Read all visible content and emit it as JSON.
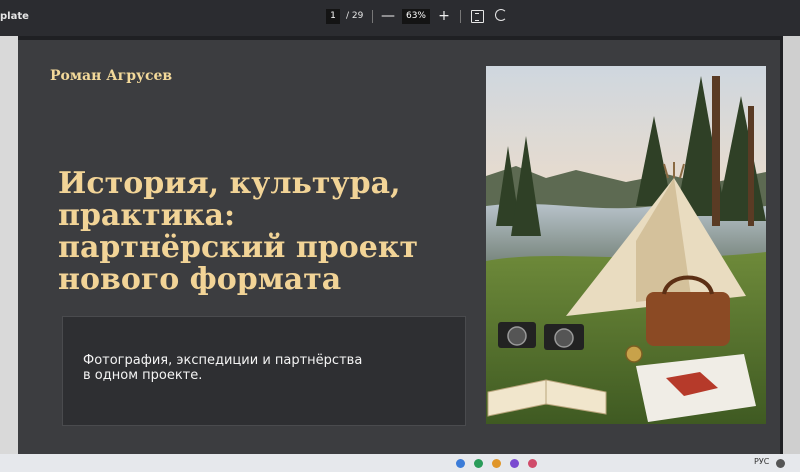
{
  "toolbar": {
    "doc_title": "plate",
    "current_page": "1",
    "page_total": "/ 29",
    "zoom_out": "—",
    "zoom_level": "63%",
    "zoom_in": "+",
    "icons": [
      "fit-page-icon",
      "rotate-icon"
    ]
  },
  "slide": {
    "author": "Роман Агрусев",
    "title_lines": [
      "История, культура,",
      "практика:",
      "партнёрский проект",
      "нового формата"
    ],
    "subtitle_lines": [
      "Фотография, экспедиции и партнёрства",
      "в одном проекте."
    ]
  },
  "taskbar": {
    "language": "РУС"
  },
  "colors": {
    "slide_bg": "#3c3d40",
    "title_gold": "#f2d497",
    "panel_bg": "#2e2f32",
    "toolbar_bg": "#2b2c30"
  }
}
